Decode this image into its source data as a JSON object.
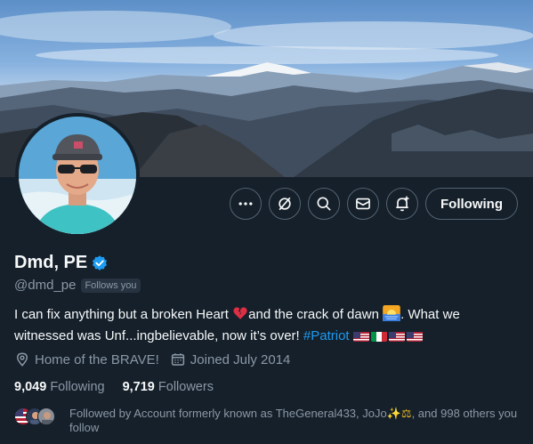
{
  "profile": {
    "display_name": "Dmd, PE",
    "handle": "@dmd_pe",
    "follows_you": "Follows you",
    "bio_part1": "I can fix anything but a broken Heart ",
    "bio_part2": "and the crack of dawn ",
    "bio_part3": ". What we witnessed was Unf...ingbelievable, now it’s over! ",
    "hashtag": "#Patriot",
    "location": "Home of the BRAVE!",
    "joined": "Joined July 2014",
    "following_count": "9,049",
    "following_label": "Following",
    "followers_count": "9,719",
    "followers_label": "Followers",
    "followed_by_prefix": "Followed by Account formerly known as TheGeneral433, JoJo",
    "followed_by_suffix": ", and 998 others you follow"
  },
  "actions": {
    "follow_label": "Following",
    "icons": [
      "more-icon",
      "grok-icon",
      "search-icon",
      "message-icon",
      "notify-icon"
    ]
  },
  "colors": {
    "background": "#15202b",
    "accent": "#1d9bf0",
    "muted_text": "#8b98a5",
    "border": "#536471"
  }
}
